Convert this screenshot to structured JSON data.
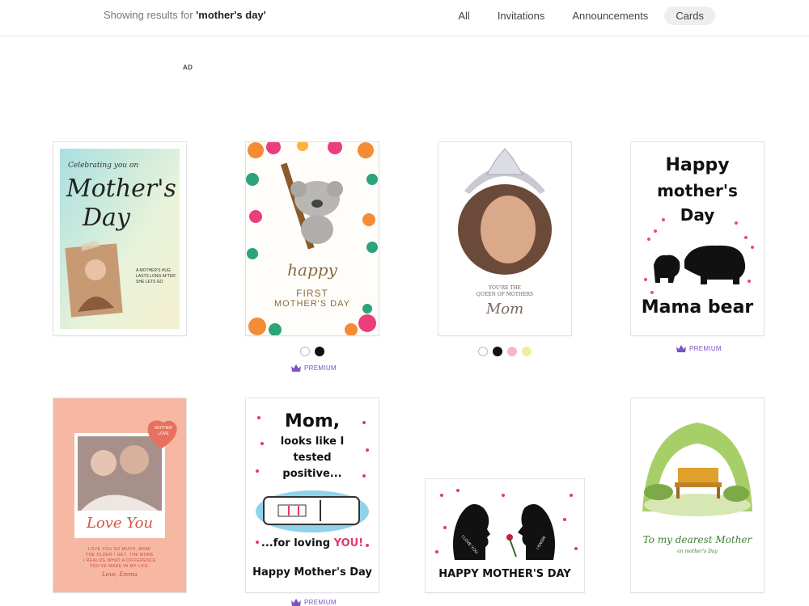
{
  "header": {
    "results_prefix": "Showing results for ",
    "query": "'mother's day'",
    "filters": [
      {
        "label": "All"
      },
      {
        "label": "Invitations"
      },
      {
        "label": "Announcements"
      },
      {
        "label": "Cards",
        "active": true
      }
    ]
  },
  "ad_label": "AD",
  "premium_label": "PREMIUM",
  "cards": [
    {
      "lines": [
        "Celebrating you on",
        "Mother's",
        "Day",
        "A MOTHER'S HUG",
        "LASTS LONG AFTER",
        "SHE LETS GO"
      ]
    },
    {
      "lines": [
        "happy",
        "FIRST",
        "MOTHER'S DAY"
      ],
      "swatches": [
        "#ffffff",
        "#111111"
      ],
      "premium": true
    },
    {
      "lines": [
        "YOU'RE THE",
        "QUEEN OF MOTHERS",
        "Mom"
      ],
      "swatches": [
        "#ffffff",
        "#111111",
        "#f2b8c9",
        "#f3ee9b"
      ]
    },
    {
      "lines": [
        "Happy",
        "mother's",
        "Day",
        "Mama bear"
      ],
      "premium": true
    },
    {
      "lines": [
        "MOTHER",
        "LOVE",
        "Love You",
        "LOVE YOU SO MUCH, MOM!",
        "THE OLDER I GET, THE MORE",
        "I REALIZE WHAT A DIFFERENCE",
        "YOU'VE MADE IN MY LIFE.",
        "Love, Emma"
      ]
    },
    {
      "lines": [
        "Mom,",
        "looks like I",
        "tested",
        "positive...",
        "...for loving ",
        "YOU!",
        "Happy Mother's Day"
      ],
      "premium": true
    },
    {
      "lines": [
        "I LOVE YOU",
        "I KNOW",
        "HAPPY MOTHER'S DAY"
      ]
    },
    {
      "lines": [
        "To my dearest Mother",
        "on mother's Day"
      ]
    }
  ],
  "colors": {
    "accent": "#7b52c4",
    "pill": "#eeeef1"
  }
}
